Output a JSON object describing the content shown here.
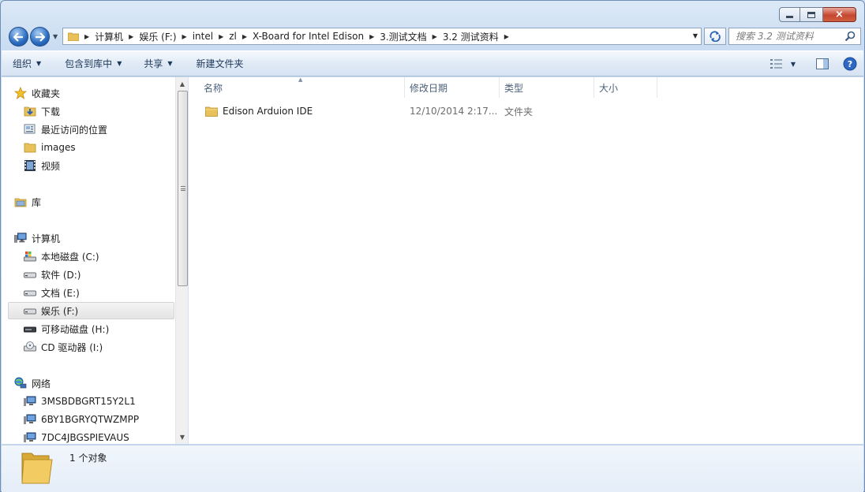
{
  "window": {
    "caption": {
      "minimize_glyph": "minimize-icon",
      "maximize_glyph": "maximize-icon",
      "close_glyph": "×"
    }
  },
  "address": {
    "crumbs": [
      "计算机",
      "娱乐 (F:)",
      "intel",
      "zl",
      "X-Board for Intel Edison",
      "3.测试文档",
      "3.2 测试资料"
    ]
  },
  "search": {
    "placeholder": "搜索 3.2 测试资料"
  },
  "toolbar": {
    "organize": "组织",
    "include_in_library": "包含到库中",
    "share": "共享",
    "new_folder": "新建文件夹"
  },
  "navigation": {
    "favorites": {
      "label": "收藏夹",
      "items": [
        "下载",
        "最近访问的位置",
        "images",
        "视频"
      ]
    },
    "libraries": {
      "label": "库"
    },
    "computer": {
      "label": "计算机",
      "items": [
        "本地磁盘 (C:)",
        "软件 (D:)",
        "文档 (E:)",
        "娱乐 (F:)",
        "可移动磁盘 (H:)",
        "CD 驱动器 (I:)"
      ],
      "selected": "娱乐 (F:)"
    },
    "network": {
      "label": "网络",
      "items": [
        "3MSBDBGRT15Y2L1",
        "6BY1BGRYQTWZMPP",
        "7DC4JBGSPIEVAUS"
      ]
    }
  },
  "columns": [
    "名称",
    "修改日期",
    "类型",
    "大小"
  ],
  "files": [
    {
      "name": "Edison Arduion IDE",
      "modified": "12/10/2014 2:17...",
      "type": "文件夹",
      "size": ""
    }
  ],
  "details": {
    "count": "1 个对象"
  },
  "colors": {
    "chrome": "#c9dcf1",
    "folder": "#e8c15a",
    "link": "#1e395b"
  }
}
